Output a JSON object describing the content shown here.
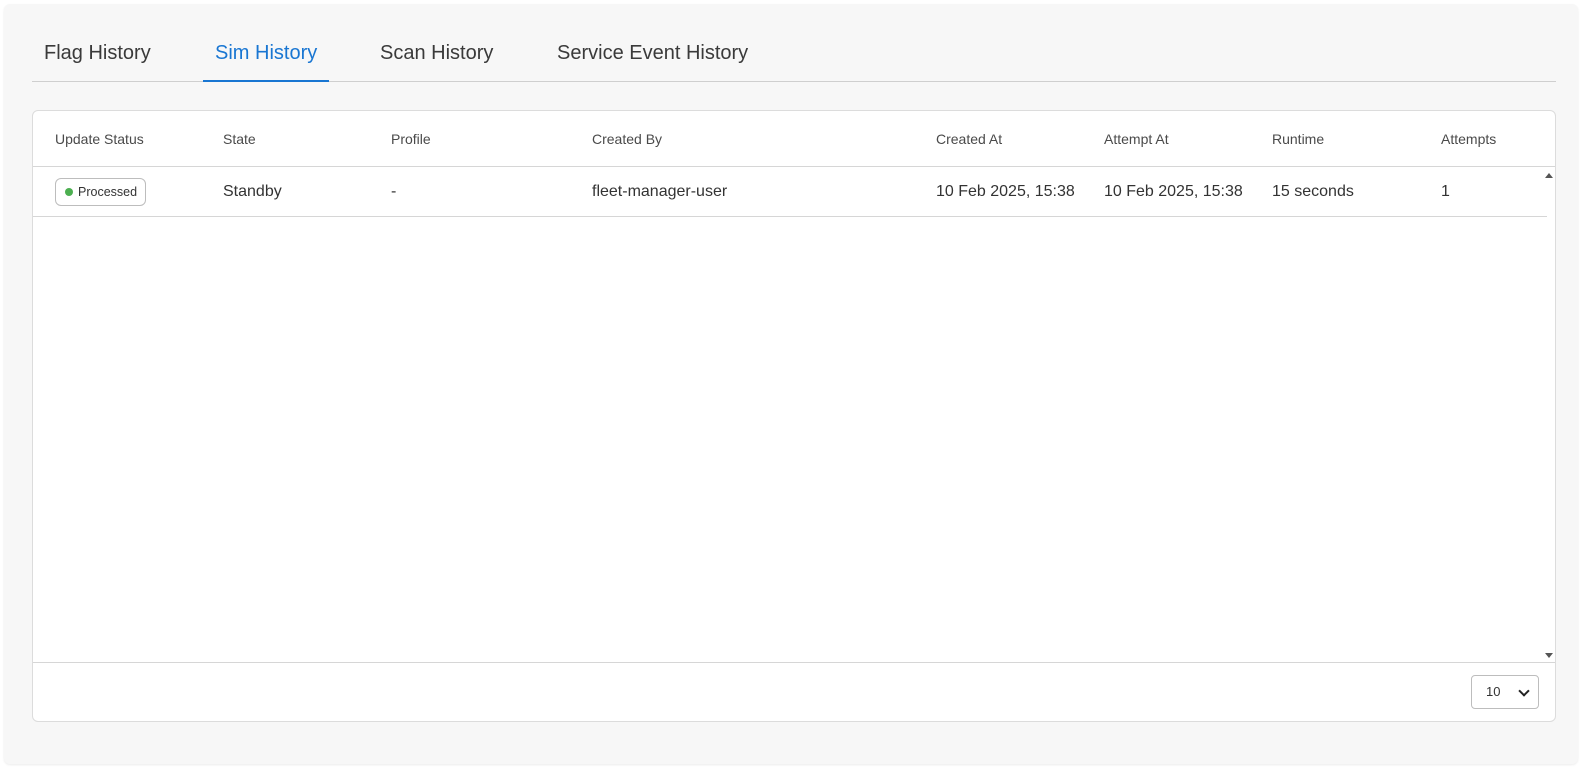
{
  "tabs": [
    {
      "label": "Flag History"
    },
    {
      "label": "Sim History"
    },
    {
      "label": "Scan History"
    },
    {
      "label": "Service Event History"
    }
  ],
  "active_tab": "Sim History",
  "table": {
    "columns": [
      "Update Status",
      "State",
      "Profile",
      "Created By",
      "Created At",
      "Attempt At",
      "Runtime",
      "Attempts"
    ],
    "rows": [
      {
        "update_status": "Processed",
        "status_color": "#4caf50",
        "state": "Standby",
        "profile": "-",
        "created_by": "fleet-manager-user",
        "created_at": "10 Feb 2025, 15:38",
        "attempt_at": "10 Feb 2025, 15:38",
        "runtime": "15 seconds",
        "attempts": "1"
      }
    ]
  },
  "pagination": {
    "page_size": "10"
  },
  "colors": {
    "accent": "#1976d2",
    "status_ok": "#4caf50"
  }
}
